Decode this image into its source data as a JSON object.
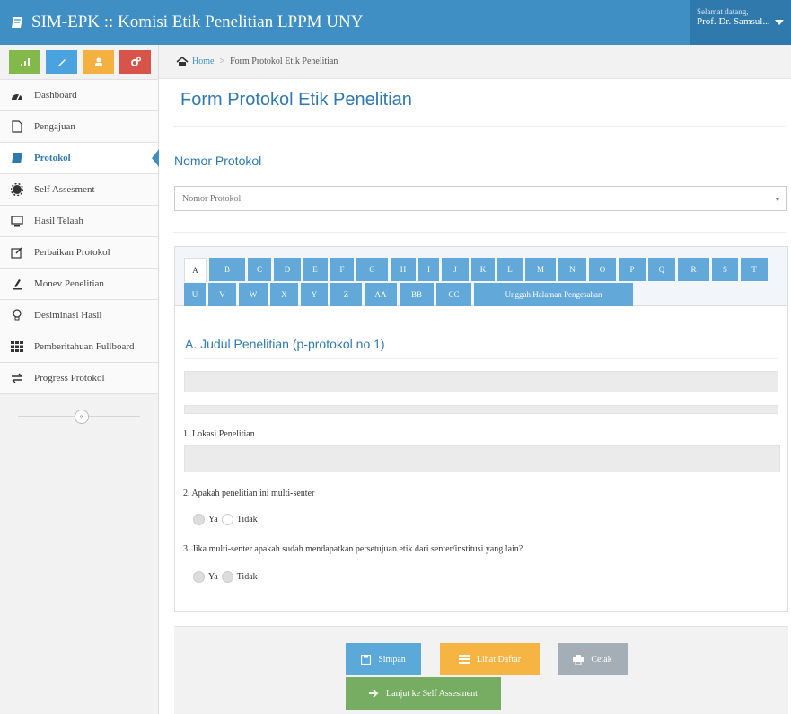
{
  "navbar": {
    "title": "SIM-EPK :: Komisi Etik Penelitian LPPM UNY",
    "greeting": "Selamat datang,",
    "user_name": "Prof. Dr. Samsul..."
  },
  "sidebar": {
    "items": [
      {
        "label": "Dashboard",
        "icon": "dashboard-icon"
      },
      {
        "label": "Pengajuan",
        "icon": "file-icon"
      },
      {
        "label": "Protokol",
        "icon": "book-icon",
        "active": true
      },
      {
        "label": "Self Assesment",
        "icon": "cog-icon"
      },
      {
        "label": "Hasil Telaah",
        "icon": "monitor-icon"
      },
      {
        "label": "Perbaikan Protokol",
        "icon": "edit-icon"
      },
      {
        "label": "Monev Penelitian",
        "icon": "pencil-icon"
      },
      {
        "label": "Desiminasi Hasil",
        "icon": "lightbulb-icon"
      },
      {
        "label": "Pemberitahuan Fullboard",
        "icon": "grid-icon"
      },
      {
        "label": "Progress Protokol",
        "icon": "exchange-icon"
      }
    ],
    "collapse_label": "«"
  },
  "breadcrumb": {
    "home": "Home",
    "sep": ">",
    "current": "Form Protokol Etik Penelitian"
  },
  "page": {
    "title": "Form Protokol Etik Penelitian",
    "section_title": "Nomor Protokol",
    "select_placeholder": "Nomor Protokol"
  },
  "tabs": {
    "row1": [
      "A",
      "B",
      "C",
      "D",
      "E",
      "F",
      "G",
      "H",
      "I",
      "J",
      "K",
      "L",
      "M",
      "N",
      "O",
      "P",
      "Q",
      "R",
      "S",
      "T"
    ],
    "row2": [
      "U",
      "V",
      "W",
      "X",
      "Y",
      "Z",
      "AA",
      "BB",
      "CC",
      "Unggah Halaman Pengesahan"
    ],
    "active": "A"
  },
  "form": {
    "heading": "A. Judul Penelitian (p-protokol no 1)",
    "q1": "1. Lokasi Penelitian",
    "q2": "2. Apakah penelitian ini multi-senter",
    "q3": "3. Jika multi-senter apakah sudah mendapatkan persetujuan etik dari senter/institusi yang lain?",
    "opt_yes": "Ya",
    "opt_no": "Tidak"
  },
  "buttons": {
    "save": "Simpan",
    "list": "Lihat Daftar",
    "print": "Cetak",
    "next": "Lanjut ke Self Assesment"
  },
  "colors": {
    "primary": "#3f8fc4",
    "tab": "#62a8d8",
    "save": "#5aa9d9",
    "list": "#f6b443",
    "print": "#a3aeb7",
    "next": "#77ad62"
  }
}
